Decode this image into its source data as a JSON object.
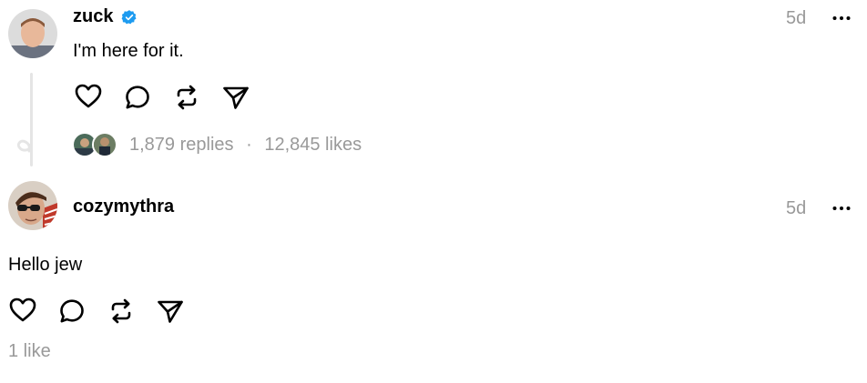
{
  "post": {
    "username": "zuck",
    "verified": true,
    "time": "5d",
    "text": "I'm here for it.",
    "replies": "1,879 replies",
    "separator": "·",
    "likes": "12,845 likes"
  },
  "reply": {
    "username": "cozymythra",
    "time": "5d",
    "text": "Hello jew",
    "likes": "1 like"
  },
  "icons": {
    "like": "heart-icon",
    "comment": "comment-icon",
    "repost": "repost-icon",
    "share": "send-icon",
    "more": "more-horizontal-icon",
    "verified": "verified-badge-icon"
  },
  "colors": {
    "verified": "#1d9bf0",
    "muted": "#999999",
    "thread_line": "#e5e5e5"
  }
}
